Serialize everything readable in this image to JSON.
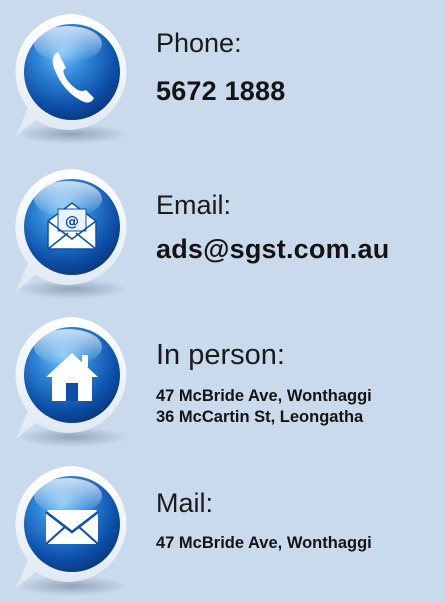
{
  "contacts": [
    {
      "icon": "phone-icon",
      "label": "Phone:",
      "lines": [
        "5672 1888"
      ]
    },
    {
      "icon": "email-icon",
      "label": "Email:",
      "lines": [
        "ads@sgst.com.au"
      ]
    },
    {
      "icon": "house-icon",
      "label": "In person:",
      "lines": [
        "47 McBride Ave, Wonthaggi",
        "36 McCartin St, Leongatha"
      ]
    },
    {
      "icon": "mail-envelope-icon",
      "label": "Mail:",
      "lines": [
        "47 McBride Ave, Wonthaggi"
      ]
    }
  ],
  "colors": {
    "background": "#c9daed",
    "icon_blue": "#1f6fc4",
    "icon_dark_blue": "#0b3f8a",
    "text": "#141414"
  }
}
